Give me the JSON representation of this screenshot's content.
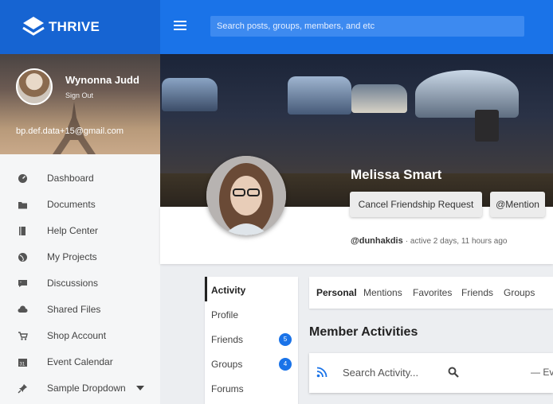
{
  "brand": {
    "name": "THRIVE"
  },
  "search": {
    "placeholder": "Search posts, groups, members, and etc"
  },
  "sidebar": {
    "user_name": "Wynonna Judd",
    "sign_out": "Sign Out",
    "email": "bp.def.data+15@gmail.com",
    "items": [
      {
        "label": "Dashboard",
        "icon": "dashboard-icon"
      },
      {
        "label": "Documents",
        "icon": "folder-icon"
      },
      {
        "label": "Help Center",
        "icon": "book-icon"
      },
      {
        "label": "My Projects",
        "icon": "globe-icon"
      },
      {
        "label": "Discussions",
        "icon": "chat-icon"
      },
      {
        "label": "Shared Files",
        "icon": "cloud-icon"
      },
      {
        "label": "Shop Account",
        "icon": "cart-icon"
      },
      {
        "label": "Event Calendar",
        "icon": "calendar-icon"
      },
      {
        "label": "Sample Dropdown",
        "icon": "pin-icon"
      }
    ],
    "calendar_day": "31"
  },
  "profile": {
    "name": "Melissa Smart",
    "cancel_button": "Cancel Friendship Request",
    "mention_button": "@Mention",
    "handle": "@dunhakdis",
    "active_meta": "· active 2 days, 11 hours ago"
  },
  "subnav": {
    "items": [
      {
        "label": "Activity"
      },
      {
        "label": "Profile"
      },
      {
        "label": "Friends",
        "badge": "5"
      },
      {
        "label": "Groups",
        "badge": "4"
      },
      {
        "label": "Forums"
      }
    ]
  },
  "tabs": [
    "Personal",
    "Mentions",
    "Favorites",
    "Friends",
    "Groups"
  ],
  "activity": {
    "title": "Member Activities",
    "search_placeholder": "Search Activity...",
    "filter_label": "— Everything —"
  },
  "colors": {
    "primary": "#1a73e8",
    "brand_bg": "#1664d2"
  }
}
